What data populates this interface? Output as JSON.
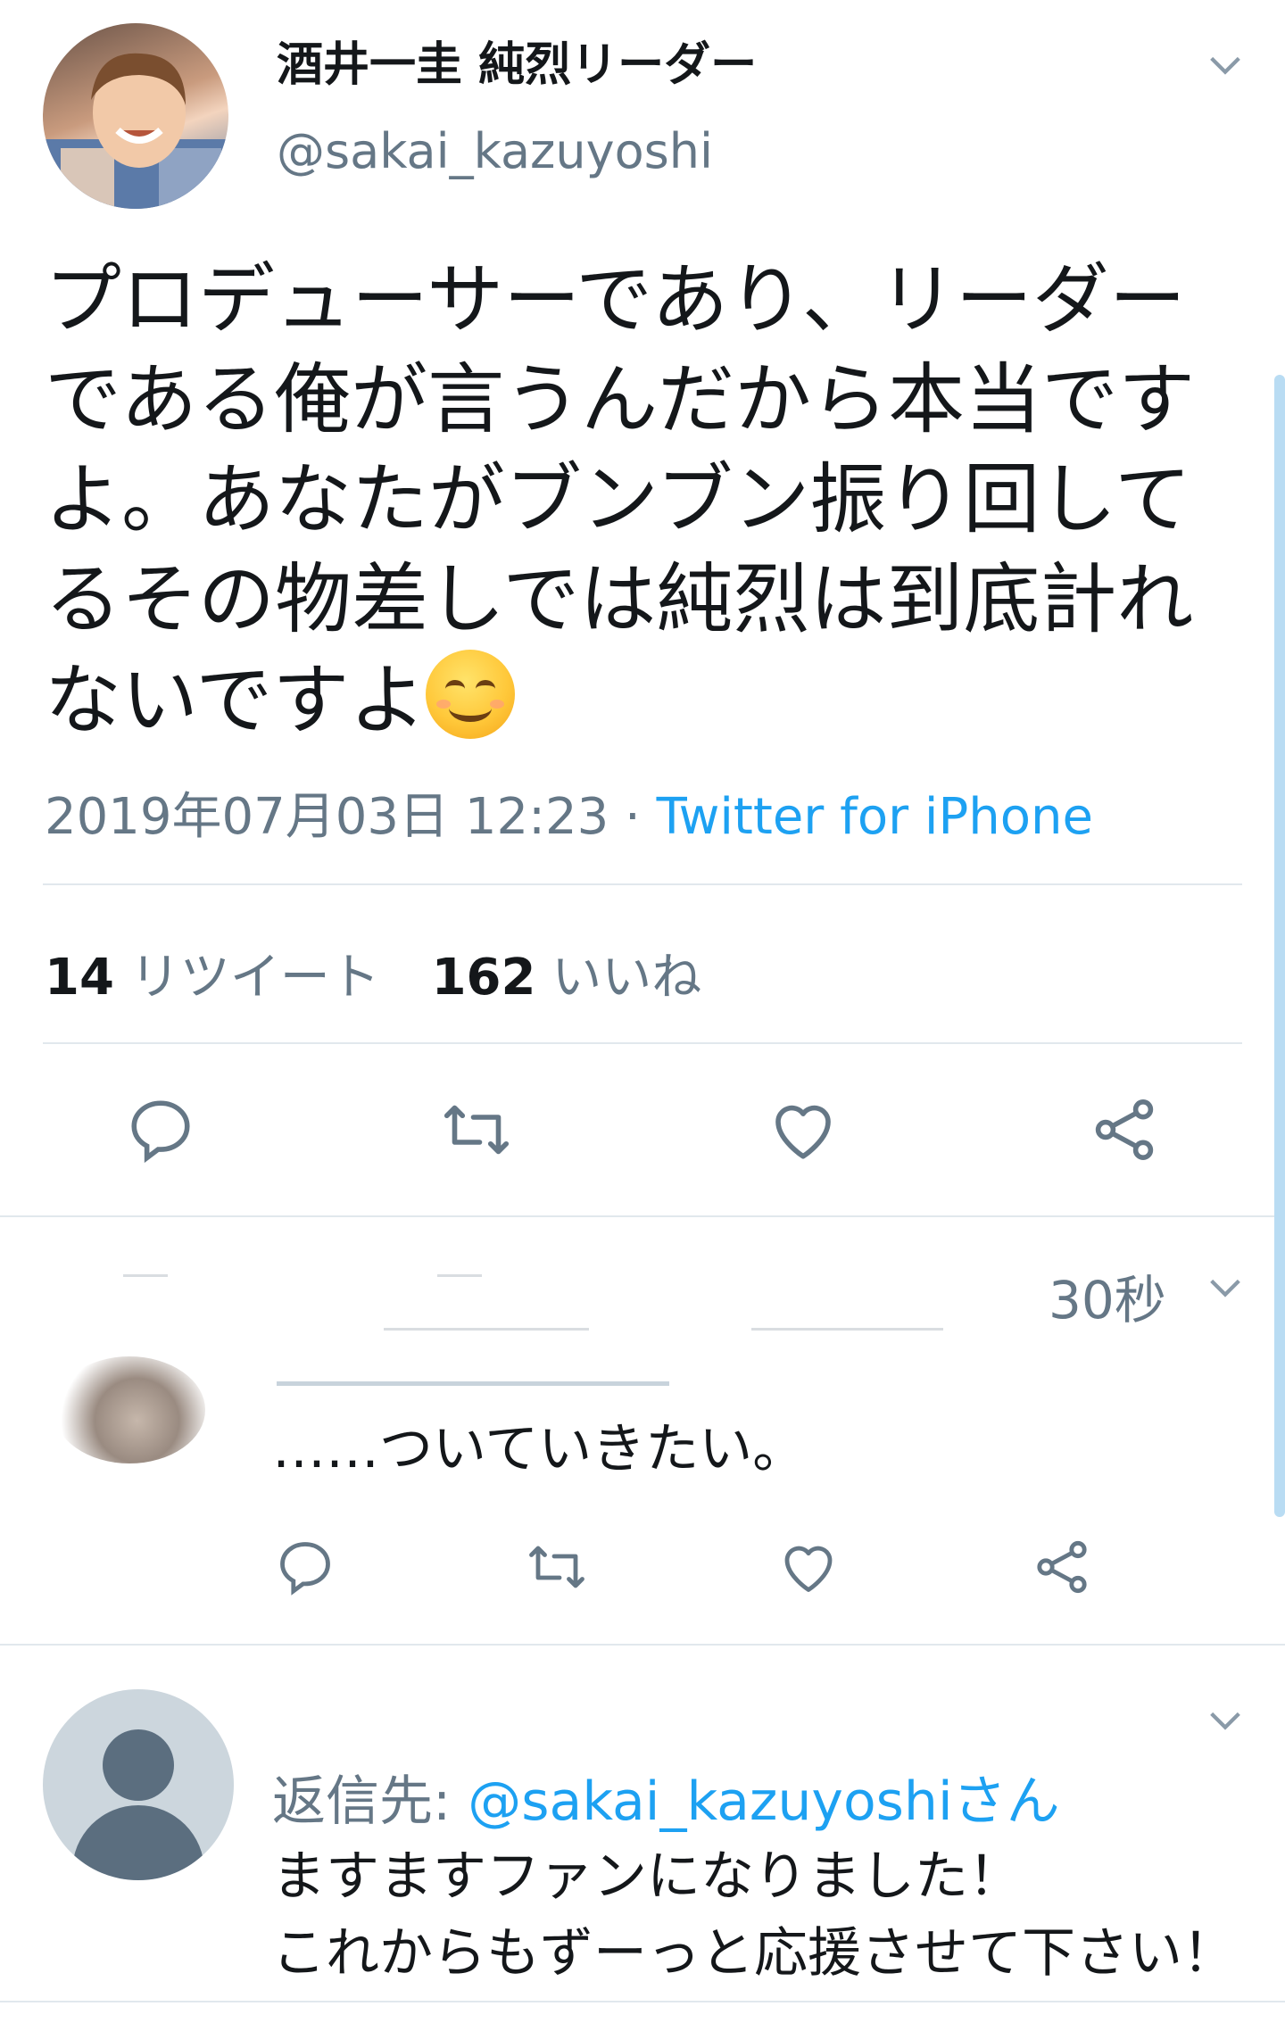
{
  "tweet": {
    "display_name": "酒井一圭 純烈リーダー",
    "handle": "@sakai_kazuyoshi",
    "text": "プロデューサーであり、リーダーである俺が言うんだから本当ですよ。あなたがブンブン振り回してるその物差しでは純烈は到底計れないですよ",
    "emoji": "smiling-face-with-smiling-eyes",
    "datetime": "2019年07月03日 12:23",
    "separator": " · ",
    "source": "Twitter for iPhone",
    "retweet_count": "14",
    "retweet_label": "リツイート",
    "like_count": "162",
    "like_label": "いいね"
  },
  "reply1": {
    "time": "30秒",
    "text": "……ついていきたい。"
  },
  "reply2": {
    "reply_to_prefix": "返信先: ",
    "reply_to_handle": "@sakai_kazuyoshiさん",
    "text": "ますますファンになりました！\nこれからもずーっと応援させて下さい！"
  },
  "colors": {
    "accent": "#1da1f2",
    "muted": "#657786",
    "divider": "#e1e8ed",
    "text": "#14171a"
  },
  "icons": [
    "chevron-down-icon",
    "reply-icon",
    "retweet-icon",
    "like-icon",
    "share-icon",
    "default-avatar-icon"
  ]
}
